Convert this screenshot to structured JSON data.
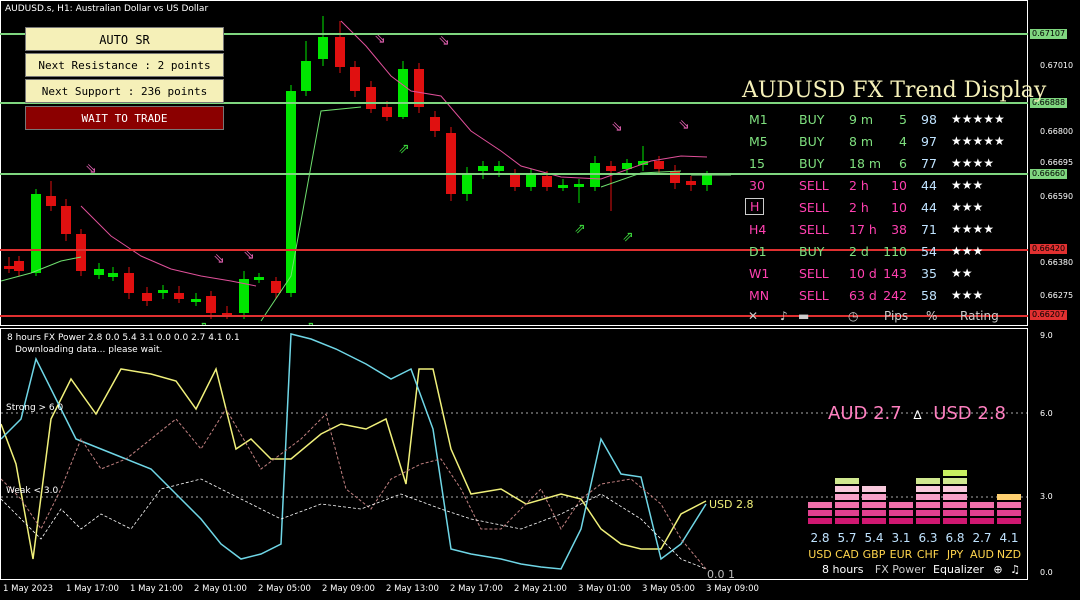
{
  "header": {
    "symbol_title": "AUDUSD.s, H1:  Australian Dollar vs US Dollar"
  },
  "panel": {
    "title": "AUTO SR",
    "next_resistance": "Next Resistance : 2 points",
    "next_support": "Next Support : 236 points",
    "status": "WAIT TO TRADE"
  },
  "price_axis": [
    "0.67107",
    "0.67010",
    "0.66888",
    "0.66800",
    "0.66695",
    "0.66660",
    "0.66590",
    "0.66420",
    "0.66380",
    "0.66275",
    "0.66207"
  ],
  "sr_levels": [
    {
      "label": "0.67107",
      "color": "#7fd67f"
    },
    {
      "label": "0.66888",
      "color": "#7fd67f"
    },
    {
      "label": "0.66660",
      "color": "#7fd67f"
    },
    {
      "label": "0.66420",
      "color": "#e03030"
    },
    {
      "label": "0.66207",
      "color": "#e03030"
    }
  ],
  "trend_display": {
    "title": "AUDUSD FX Trend Display",
    "rows": [
      {
        "tf": "M1",
        "signal": "BUY",
        "age": "9 m",
        "pips": "5",
        "pct": "98",
        "stars": "★★★★★"
      },
      {
        "tf": "M5",
        "signal": "BUY",
        "age": "8 m",
        "pips": "4",
        "pct": "97",
        "stars": "★★★★★"
      },
      {
        "tf": "15",
        "signal": "BUY",
        "age": "18 m",
        "pips": "6",
        "pct": "77",
        "stars": "★★★★"
      },
      {
        "tf": "30",
        "signal": "SELL",
        "age": "2 h",
        "pips": "10",
        "pct": "44",
        "stars": "★★★"
      },
      {
        "tf": "H",
        "signal": "SELL",
        "age": "2 h",
        "pips": "10",
        "pct": "44",
        "stars": "★★★"
      },
      {
        "tf": "H4",
        "signal": "SELL",
        "age": "17 h",
        "pips": "38",
        "pct": "71",
        "stars": "★★★★"
      },
      {
        "tf": "D1",
        "signal": "BUY",
        "age": "2 d",
        "pips": "110",
        "pct": "54",
        "stars": "★★★"
      },
      {
        "tf": "W1",
        "signal": "SELL",
        "age": "10 d",
        "pips": "143",
        "pct": "35",
        "stars": "★★"
      },
      {
        "tf": "MN",
        "signal": "SELL",
        "age": "63 d",
        "pips": "242",
        "pct": "58",
        "stars": "★★★"
      }
    ],
    "footer": {
      "close": "✕",
      "pin": "♪",
      "line": "▬",
      "clock": "◷",
      "pips": "Pips",
      "pct": "%",
      "rating": "Rating"
    }
  },
  "indicator": {
    "header": "8 hours FX Power 2.8 0.0 5.4 3.1 0.0 0.0 2.7 4.1 0.1",
    "status": "Downloading data... please wait.",
    "strong_label": "Strong > 6.0",
    "weak_label": "Weak < 3.0",
    "usd_label": "USD 2.8",
    "zero_label": "0.0 1",
    "axis": [
      "9.0",
      "6.0",
      "3.0",
      "0.0"
    ],
    "pair_aud": "AUD 2.7",
    "pair_delta": "∆",
    "pair_usd": "USD 2.8"
  },
  "equalizer": {
    "values": [
      "2.8",
      "5.7",
      "5.4",
      "3.1",
      "6.3",
      "6.8",
      "2.7",
      "4.1"
    ],
    "currencies": [
      "USD",
      "CAD",
      "GBP",
      "EUR",
      "CHF",
      "JPY",
      "AUD",
      "NZD"
    ],
    "levels": [
      2.8,
      5.7,
      5.4,
      3.1,
      6.3,
      6.8,
      2.7,
      4.1
    ],
    "footer_hours": "8 hours",
    "footer_title": "FX Power",
    "footer_eq": "Equalizer"
  },
  "time_axis": [
    "1 May 2023",
    "1 May 17:00",
    "1 May 21:00",
    "2 May 01:00",
    "2 May 05:00",
    "2 May 09:00",
    "2 May 13:00",
    "2 May 17:00",
    "2 May 21:00",
    "3 May 01:00",
    "3 May 05:00",
    "3 May 09:00"
  ],
  "colors": {
    "bull": "#00e600",
    "bear": "#e01010",
    "arrow_up": "#3cd63c",
    "arrow_down": "#e060b0",
    "ma": "#e0509a",
    "trend_line": "#6fe06f"
  }
}
